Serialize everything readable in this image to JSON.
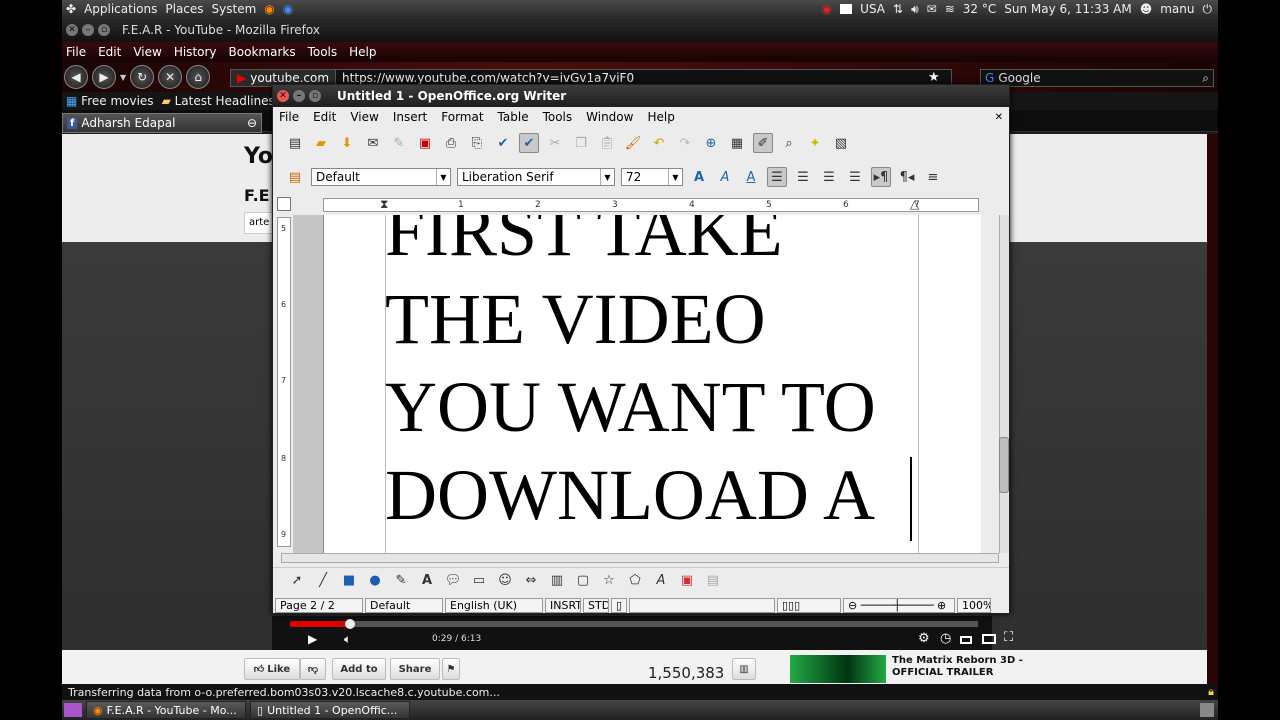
{
  "top_panel": {
    "menus": [
      "Applications",
      "Places",
      "System"
    ],
    "keyboard_layout": "USA",
    "temperature": "32 °C",
    "datetime": "Sun May 6, 11:33 AM",
    "user": "manu"
  },
  "firefox": {
    "title": "F.E.A.R - YouTube - Mozilla Firefox",
    "menu": [
      "File",
      "Edit",
      "View",
      "History",
      "Bookmarks",
      "Tools",
      "Help"
    ],
    "site_label": "youtube.com",
    "url": "https://www.youtube.com/watch?v=ivGv1a7viF0",
    "search_placeholder": "Google",
    "bookmarks": [
      "Free movies",
      "Latest Headlines"
    ],
    "tab": "Adharsh Edapal",
    "status": "Transferring data from o-o.preferred.bom03s03.v20.lscache8.c.youtube.com..."
  },
  "youtube": {
    "header_title": "You",
    "video_title": "F.E",
    "channel_fragment": "arte",
    "player_time": "0:29 / 6:13",
    "progress_fraction": 0.087,
    "like_label": "Like",
    "add_to_label": "Add to",
    "share_label": "Share",
    "views": "1,550,383",
    "related_title": "The Matrix Reborn 3D -",
    "related_subtitle": "OFFICIAL TRAILER"
  },
  "writer": {
    "title": "Untitled 1 - OpenOffice.org Writer",
    "menu": [
      "File",
      "Edit",
      "View",
      "Insert",
      "Format",
      "Table",
      "Tools",
      "Window",
      "Help"
    ],
    "paragraph_style": "Default",
    "font_name": "Liberation Serif",
    "font_size": "72",
    "hruler_numbers": [
      "1",
      "2",
      "3",
      "4",
      "5",
      "6",
      "7"
    ],
    "vruler_numbers": [
      "5",
      "6",
      "7",
      "8",
      "9"
    ],
    "document_lines": [
      "FIRST TAKE",
      "THE VIDEO",
      "YOU WANT TO",
      "DOWNLOAD A"
    ],
    "status": {
      "page": "Page 2 / 2",
      "style": "Default",
      "language": "English (UK)",
      "insert_mode": "INSRT",
      "selection_mode": "STD",
      "zoom": "100%"
    }
  },
  "taskbar": {
    "items": [
      "F.E.A.R - YouTube - Mo...",
      "Untitled 1 - OpenOffic..."
    ]
  }
}
